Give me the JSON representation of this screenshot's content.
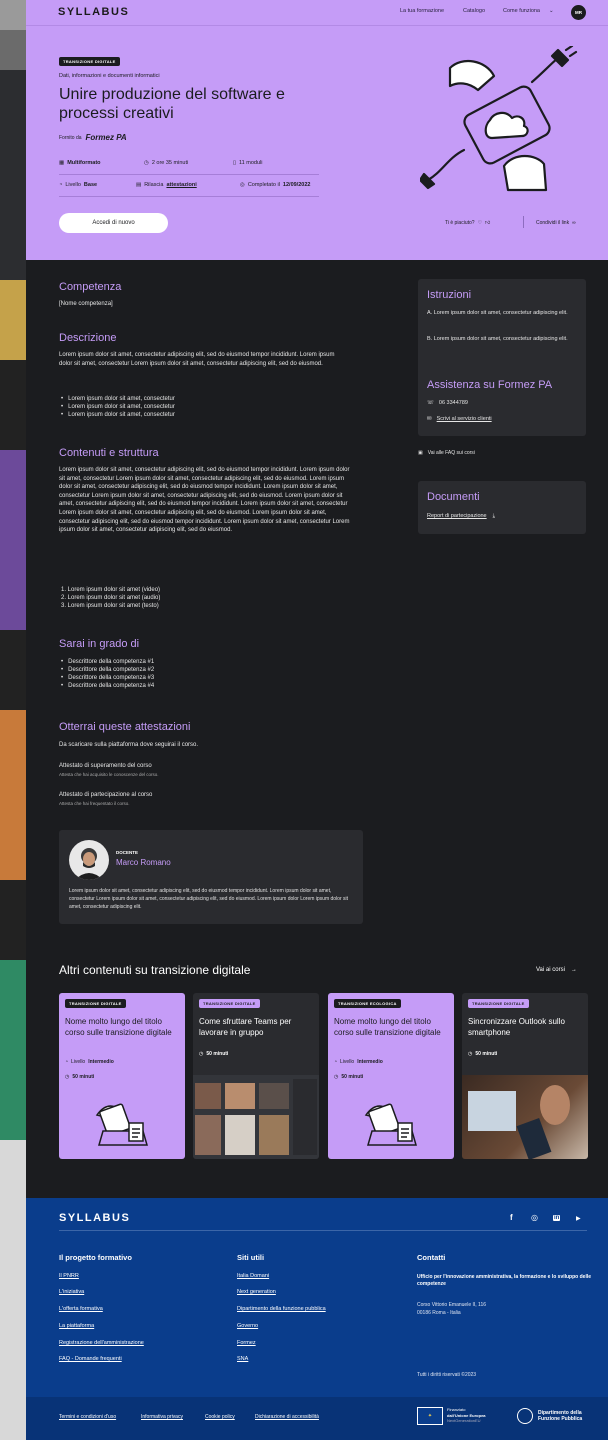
{
  "brand": {
    "logo": "SYLLABUS"
  },
  "nav": {
    "links": [
      "La tua formazione",
      "Catalogo",
      "Come funziona"
    ],
    "avatar": "MR"
  },
  "hero": {
    "tag": "TRANSIZIONE DIGITALE",
    "subtitle": "Dati, informazioni e documenti informatici",
    "title_line1": "Unire produzione del software e",
    "title_line2": "processi creativi",
    "provided_label": "Fornito da",
    "provider": "Formez PA",
    "meta": [
      {
        "icon": "multiformat-icon",
        "label": "Multiformato"
      },
      {
        "icon": "clock-icon",
        "label": "2 ore 35 minuti"
      },
      {
        "icon": "modules-icon",
        "label": "11 moduli"
      }
    ],
    "meta2": [
      {
        "icon": "level-icon",
        "prefix": "Livello",
        "value": "Base"
      },
      {
        "icon": "certificate-icon",
        "prefix": "Rilascia",
        "value": "attestazioni"
      },
      {
        "icon": "check-circle-icon",
        "prefix": "Completato il",
        "value": "12/09/2022"
      }
    ],
    "cta": "Accedi di nuovo",
    "liked": "Ti è piaciuto?",
    "share": "Condividi il link"
  },
  "content": {
    "competenza_title": "Competenza",
    "competenza_text": "[Nome competenza]",
    "descrizione_title": "Descrizione",
    "descrizione_text": "Lorem ipsum dolor sit amet, consectetur adipiscing elit, sed do eiusmod tempor incididunt. Lorem ipsum dolor sit amet, consectetur Lorem ipsum dolor sit amet, consectetur adipiscing elit, sed do eiusmod.",
    "descrizione_list": [
      "Lorem ipsum dolor sit amet, consectetur",
      "Lorem ipsum dolor sit amet, consectetur",
      "Lorem ipsum dolor sit amet, consectetur"
    ],
    "contenuti_title": "Contenuti e struttura",
    "contenuti_text": "Lorem ipsum dolor sit amet, consectetur adipiscing elit, sed do eiusmod tempor incididunt. Lorem ipsum dolor sit amet, consectetur Lorem ipsum dolor sit amet, consectetur adipiscing elit, sed do eiusmod. Lorem ipsum dolor sit amet, consectetur adipiscing elit, sed do eiusmod tempor incididunt. Lorem ipsum dolor sit amet, consectetur Lorem ipsum dolor sit amet, consectetur adipiscing elit, sed do eiusmod. Lorem ipsum dolor sit amet, consectetur adipiscing elit, sed do eiusmod tempor incididunt. Lorem ipsum dolor sit amet, consectetur Lorem ipsum dolor sit amet, consectetur adipiscing elit, sed do eiusmod. Lorem ipsum dolor sit amet, consectetur adipiscing elit, sed do eiusmod tempor incididunt. Lorem ipsum dolor sit amet, consectetur Lorem ipsum dolor sit amet, consectetur adipiscing elit, sed do eiusmod.",
    "contenuti_list": [
      "1. Lorem ipsum dolor sit amet (video)",
      "2. Lorem ipsum dolor sit amet (audio)",
      "3. Lorem ipsum dolor sit amet (testo)"
    ],
    "sarai_title": "Sarai in grado di",
    "sarai_list": [
      "Descrittore della competenza #1",
      "Descrittore della competenza #2",
      "Descrittore della competenza #3",
      "Descrittore della competenza #4"
    ],
    "attestazioni_title": "Otterrai queste attestazioni",
    "attestazioni_text": "Da scaricare sulla piattaforma dove seguirai il corso.",
    "att1_title": "Attestato di superamento del corso",
    "att1_sub": "Attesta che hai acquisito le conoscenze del corso.",
    "att2_title": "Attestato di partecipazione al corso",
    "att2_sub": "Attesta che hai frequentato il corso."
  },
  "teacher": {
    "label": "DOCENTE",
    "name": "Marco Romano",
    "bio": "Lorem ipsum dolor sit amet, consectetur adipiscing elit, sed do eiusmod tempor incididunt. Lorem ipsum dolor sit amet, consectetur Lorem ipsum dolor sit amet, consectetur adipiscing elit, sed do eiusmod. Lorem ipsum dolor Lorem ipsum dolor sit amet, consectetur adipiscing elit."
  },
  "sidebar": {
    "istruzioni_title": "Istruzioni",
    "istruzioni_a": "A. Lorem ipsum dolor sit amet, consectetur adipiscing elit.",
    "istruzioni_b": "B. Lorem ipsum dolor sit amet, consectetur adipiscing elit.",
    "assistenza_title": "Assistenza su Formez PA",
    "phone": "06 3344789",
    "contact_link": "Scrivi al servizio clienti",
    "faq": "Vai alle FAQ sui corsi",
    "documenti_title": "Documenti",
    "report_link": "Report di partecipazione"
  },
  "related": {
    "title": "Altri contenuti su transizione digitale",
    "all_link": "Vai ai corsi",
    "cards": [
      {
        "tag": "TRANSIZIONE DIGITALE",
        "title": "Nome molto lungo del titolo corso sulle transizione digitale",
        "level_prefix": "Livello",
        "level": "Intermedio",
        "duration": "50 minuti"
      },
      {
        "tag": "TRANSIZIONE DIGITALE",
        "title": "Come sfruttare Teams per lavorare in gruppo",
        "duration": "50 minuti"
      },
      {
        "tag": "TRANSIZIONE ECOLOGICA",
        "title": "Nome molto lungo del titolo corso sulle transizione digitale",
        "level_prefix": "Livello",
        "level": "Intermedio",
        "duration": "50 minuti"
      },
      {
        "tag": "TRANSIZIONE DIGITALE",
        "title": "Sincronizzare Outlook sullo smartphone",
        "duration": "50 minuti"
      }
    ]
  },
  "footer": {
    "logo": "SYLLABUS",
    "social": [
      "f",
      "◎",
      "in",
      "▶"
    ],
    "col1_title": "Il progetto formativo",
    "col1_links": [
      "Il PNRR",
      "L'iniziativa",
      "L'offerta formativa",
      "La piattaforma",
      "Registrazione dell'amministrazione",
      "FAQ - Domande frequenti"
    ],
    "col2_title": "Siti utili",
    "col2_links": [
      "Italia Domani",
      "Next generation",
      "Dipartimento della funzione pubblica",
      "Governo",
      "Formez",
      "SNA"
    ],
    "col3_title": "Contatti",
    "office": "Ufficio per l'innovazione amministrativa, la formazione e lo sviluppo delle competenze",
    "address1": "Corso Vittorio Emanuele II, 116",
    "address2": "00186 Roma - Italia",
    "rights": "Tutti i diritti riservati ©2023",
    "bottom_links": [
      "Termini e condizioni d'uso",
      "Informativa privacy",
      "Cookie policy",
      "Dichiarazione di accessibilità"
    ],
    "eu_line1": "Finanziato",
    "eu_line2": "dall'Unione Europea",
    "eu_line3": "NextGenerationEU",
    "dfp_line1": "Dipartimento della",
    "dfp_line2": "Funzione Pubblica"
  },
  "colors": {
    "lavender": "#c59cf7",
    "dark": "#1b1c1f",
    "panel": "#2a2b2f",
    "footer": "#0a3d8c"
  }
}
